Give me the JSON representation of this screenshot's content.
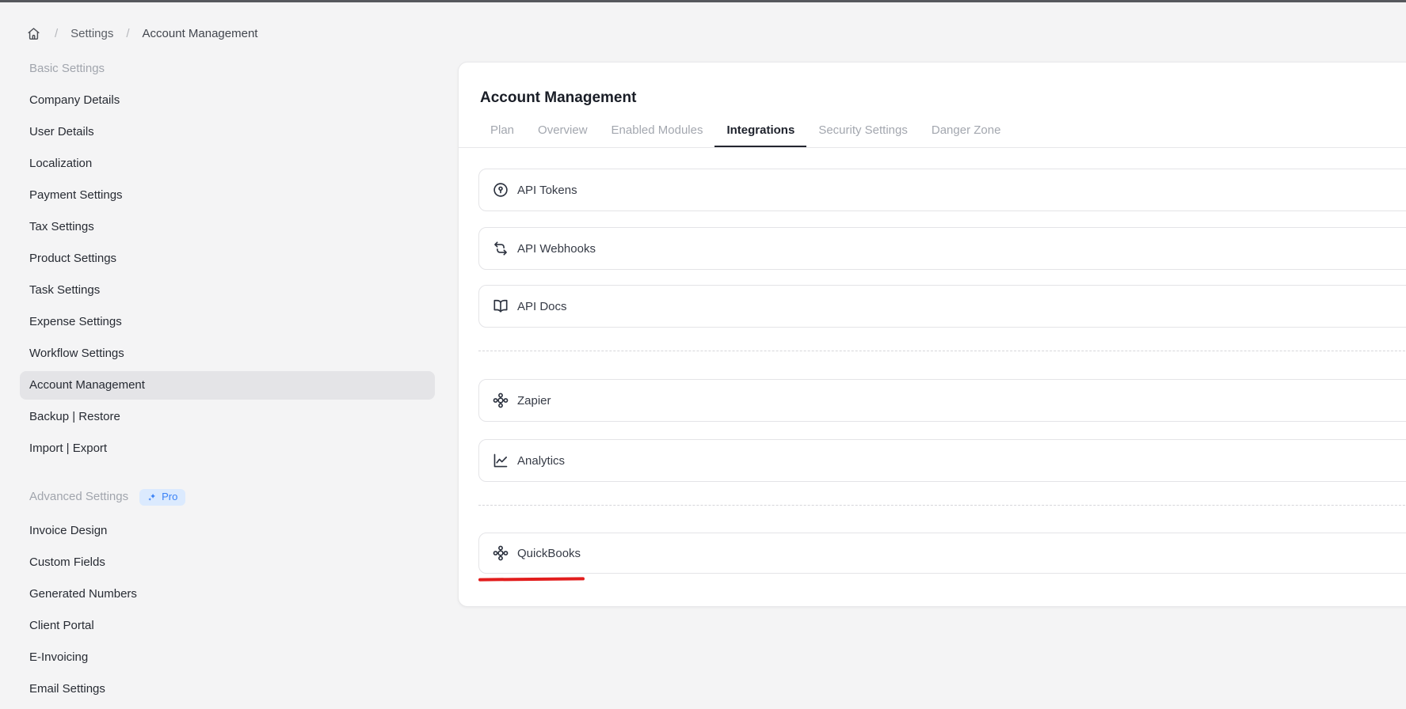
{
  "breadcrumb": {
    "home_icon": "home-icon",
    "items": [
      {
        "label": "Settings",
        "current": false
      },
      {
        "label": "Account Management",
        "current": true
      }
    ],
    "separator": "/"
  },
  "sidebar": {
    "sections": [
      {
        "header": "Basic Settings",
        "badge": null,
        "items": [
          {
            "label": "Company Details",
            "active": false
          },
          {
            "label": "User Details",
            "active": false
          },
          {
            "label": "Localization",
            "active": false
          },
          {
            "label": "Payment Settings",
            "active": false
          },
          {
            "label": "Tax Settings",
            "active": false
          },
          {
            "label": "Product Settings",
            "active": false
          },
          {
            "label": "Task Settings",
            "active": false
          },
          {
            "label": "Expense Settings",
            "active": false
          },
          {
            "label": "Workflow Settings",
            "active": false
          },
          {
            "label": "Account Management",
            "active": true
          },
          {
            "label": "Backup | Restore",
            "active": false
          },
          {
            "label": "Import | Export",
            "active": false
          }
        ]
      },
      {
        "header": "Advanced Settings",
        "badge": {
          "label": "Pro",
          "icon": "sparkles-icon",
          "text_color": "#3b82f6",
          "bg_color": "#dbeafe"
        },
        "items": [
          {
            "label": "Invoice Design",
            "active": false
          },
          {
            "label": "Custom Fields",
            "active": false
          },
          {
            "label": "Generated Numbers",
            "active": false
          },
          {
            "label": "Client Portal",
            "active": false
          },
          {
            "label": "E-Invoicing",
            "active": false
          },
          {
            "label": "Email Settings",
            "active": false
          }
        ]
      }
    ]
  },
  "main": {
    "title": "Account Management",
    "tabs": [
      {
        "label": "Plan",
        "active": false
      },
      {
        "label": "Overview",
        "active": false
      },
      {
        "label": "Enabled Modules",
        "active": false
      },
      {
        "label": "Integrations",
        "active": true
      },
      {
        "label": "Security Settings",
        "active": false
      },
      {
        "label": "Danger Zone",
        "active": false
      }
    ],
    "integration_groups": [
      {
        "items": [
          {
            "label": "API Tokens",
            "icon": "token-icon"
          },
          {
            "label": "API Webhooks",
            "icon": "swap-arrows-icon"
          },
          {
            "label": "API Docs",
            "icon": "open-book-icon"
          }
        ]
      },
      {
        "items": [
          {
            "label": "Zapier",
            "icon": "hub-icon"
          },
          {
            "label": "Analytics",
            "icon": "line-chart-icon"
          }
        ]
      },
      {
        "items": [
          {
            "label": "QuickBooks",
            "icon": "hub-icon",
            "annotated": true
          }
        ]
      }
    ],
    "annotation": {
      "type": "red-underline",
      "color": "#e21d1d",
      "target": "QuickBooks"
    }
  },
  "colors": {
    "page_bg": "#f4f4f5",
    "card_bg": "#ffffff",
    "active_pill": "#e4e4e7",
    "tab_active_text": "#1e222c",
    "tab_inactive_text": "#a3a7af",
    "accent_blue": "#3b82f6",
    "annotation_red": "#e21d1d"
  }
}
